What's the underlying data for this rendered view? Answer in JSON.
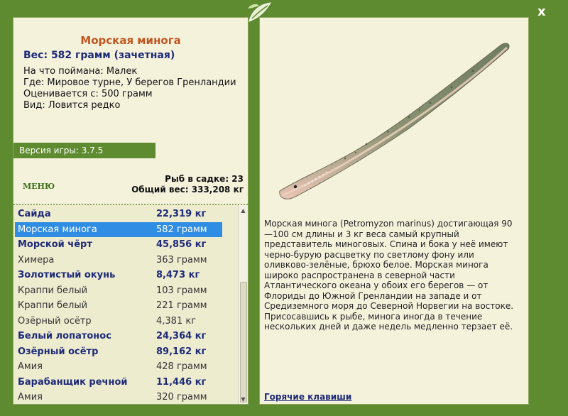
{
  "fish": {
    "name": "Морская минога",
    "weight_line": "Вес: 582 грамм (зачетная)",
    "caught_on": "На что поймана: Малек",
    "location": "Где: Мировое турне, У берегов Гренландии",
    "valued_from": "Оценивается с: 500 грамм",
    "kind": "Вид: Ловится редко"
  },
  "version": "Версия игры: 3.7.5",
  "menu_label": "МЕНЮ",
  "stats": {
    "fish_count": "Рыб в садке: 23",
    "total_weight": "Общий вес: 333,208 кг"
  },
  "list": [
    {
      "name": "Сайда",
      "weight": "22,319 кг",
      "style": "bold"
    },
    {
      "name": "Морская минога",
      "weight": "582 грамм",
      "style": "selected"
    },
    {
      "name": "Морской чёрт",
      "weight": "45,856 кг",
      "style": "bold"
    },
    {
      "name": "Химера",
      "weight": "363 грамм",
      "style": "plain"
    },
    {
      "name": "Золотистый окунь",
      "weight": "8,473 кг",
      "style": "bold"
    },
    {
      "name": "Краппи белый",
      "weight": "103 грамм",
      "style": "plain"
    },
    {
      "name": "Краппи белый",
      "weight": "221 грамм",
      "style": "plain"
    },
    {
      "name": "Озёрный осётр",
      "weight": "4,381 кг",
      "style": "plain"
    },
    {
      "name": "Белый лопатонос",
      "weight": "24,364 кг",
      "style": "bold"
    },
    {
      "name": "Озёрный осётр",
      "weight": "89,162 кг",
      "style": "bold"
    },
    {
      "name": "Амия",
      "weight": "428 грамм",
      "style": "plain"
    },
    {
      "name": "Барабанщик речной",
      "weight": "11,446 кг",
      "style": "bold"
    },
    {
      "name": "Амия",
      "weight": "320 грамм",
      "style": "plain"
    }
  ],
  "description": "Морская минога (Petromyzon marinus) достигающая 90—100 см длины и 3 кг веса самый крупный представитель миноговых. Спина и бока у неё имеют черно-бурую расцветку по светлому фону или оливково-зелёные, брюхо белое. Морская минога широко распространена в северной части Атлантического океана у обоих его берегов — от Флориды до Южной Гренландии на западе и от Средиземного моря до Северной Норвегии на востоке. Присосавшись к рыбе, минога иногда в течение нескольких дней и даже недель медленно терзает её.",
  "hotkeys_label": "Горячие клавиши",
  "close_label": "x",
  "colors": {
    "frame_green": "#5e8b2f",
    "panel_bg": "#f5f2dc",
    "title_orange": "#c0561e",
    "bold_blue": "#1e2a7a",
    "selection_blue": "#2f8de4"
  }
}
